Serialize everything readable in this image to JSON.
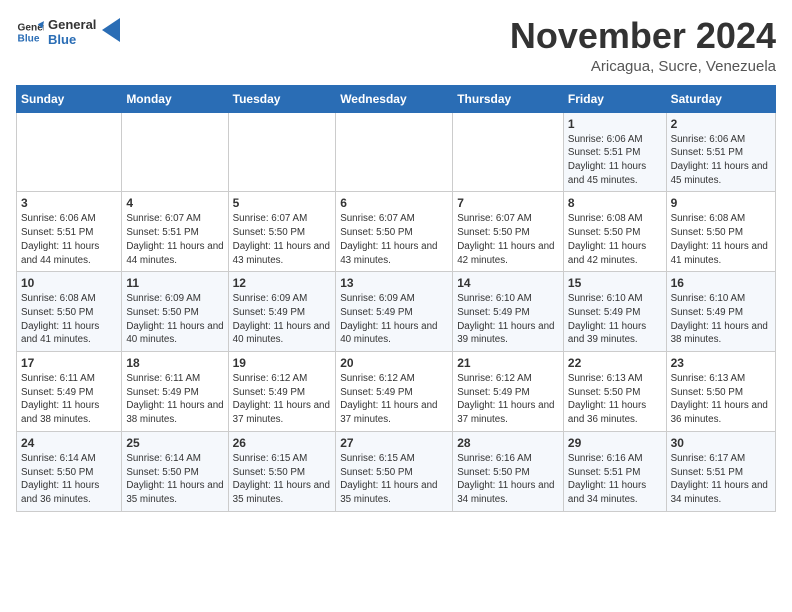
{
  "header": {
    "logo_general": "General",
    "logo_blue": "Blue",
    "month": "November 2024",
    "location": "Aricagua, Sucre, Venezuela"
  },
  "days_of_week": [
    "Sunday",
    "Monday",
    "Tuesday",
    "Wednesday",
    "Thursday",
    "Friday",
    "Saturday"
  ],
  "weeks": [
    [
      {
        "day": "",
        "info": ""
      },
      {
        "day": "",
        "info": ""
      },
      {
        "day": "",
        "info": ""
      },
      {
        "day": "",
        "info": ""
      },
      {
        "day": "",
        "info": ""
      },
      {
        "day": "1",
        "info": "Sunrise: 6:06 AM\nSunset: 5:51 PM\nDaylight: 11 hours and 45 minutes."
      },
      {
        "day": "2",
        "info": "Sunrise: 6:06 AM\nSunset: 5:51 PM\nDaylight: 11 hours and 45 minutes."
      }
    ],
    [
      {
        "day": "3",
        "info": "Sunrise: 6:06 AM\nSunset: 5:51 PM\nDaylight: 11 hours and 44 minutes."
      },
      {
        "day": "4",
        "info": "Sunrise: 6:07 AM\nSunset: 5:51 PM\nDaylight: 11 hours and 44 minutes."
      },
      {
        "day": "5",
        "info": "Sunrise: 6:07 AM\nSunset: 5:50 PM\nDaylight: 11 hours and 43 minutes."
      },
      {
        "day": "6",
        "info": "Sunrise: 6:07 AM\nSunset: 5:50 PM\nDaylight: 11 hours and 43 minutes."
      },
      {
        "day": "7",
        "info": "Sunrise: 6:07 AM\nSunset: 5:50 PM\nDaylight: 11 hours and 42 minutes."
      },
      {
        "day": "8",
        "info": "Sunrise: 6:08 AM\nSunset: 5:50 PM\nDaylight: 11 hours and 42 minutes."
      },
      {
        "day": "9",
        "info": "Sunrise: 6:08 AM\nSunset: 5:50 PM\nDaylight: 11 hours and 41 minutes."
      }
    ],
    [
      {
        "day": "10",
        "info": "Sunrise: 6:08 AM\nSunset: 5:50 PM\nDaylight: 11 hours and 41 minutes."
      },
      {
        "day": "11",
        "info": "Sunrise: 6:09 AM\nSunset: 5:50 PM\nDaylight: 11 hours and 40 minutes."
      },
      {
        "day": "12",
        "info": "Sunrise: 6:09 AM\nSunset: 5:49 PM\nDaylight: 11 hours and 40 minutes."
      },
      {
        "day": "13",
        "info": "Sunrise: 6:09 AM\nSunset: 5:49 PM\nDaylight: 11 hours and 40 minutes."
      },
      {
        "day": "14",
        "info": "Sunrise: 6:10 AM\nSunset: 5:49 PM\nDaylight: 11 hours and 39 minutes."
      },
      {
        "day": "15",
        "info": "Sunrise: 6:10 AM\nSunset: 5:49 PM\nDaylight: 11 hours and 39 minutes."
      },
      {
        "day": "16",
        "info": "Sunrise: 6:10 AM\nSunset: 5:49 PM\nDaylight: 11 hours and 38 minutes."
      }
    ],
    [
      {
        "day": "17",
        "info": "Sunrise: 6:11 AM\nSunset: 5:49 PM\nDaylight: 11 hours and 38 minutes."
      },
      {
        "day": "18",
        "info": "Sunrise: 6:11 AM\nSunset: 5:49 PM\nDaylight: 11 hours and 38 minutes."
      },
      {
        "day": "19",
        "info": "Sunrise: 6:12 AM\nSunset: 5:49 PM\nDaylight: 11 hours and 37 minutes."
      },
      {
        "day": "20",
        "info": "Sunrise: 6:12 AM\nSunset: 5:49 PM\nDaylight: 11 hours and 37 minutes."
      },
      {
        "day": "21",
        "info": "Sunrise: 6:12 AM\nSunset: 5:49 PM\nDaylight: 11 hours and 37 minutes."
      },
      {
        "day": "22",
        "info": "Sunrise: 6:13 AM\nSunset: 5:50 PM\nDaylight: 11 hours and 36 minutes."
      },
      {
        "day": "23",
        "info": "Sunrise: 6:13 AM\nSunset: 5:50 PM\nDaylight: 11 hours and 36 minutes."
      }
    ],
    [
      {
        "day": "24",
        "info": "Sunrise: 6:14 AM\nSunset: 5:50 PM\nDaylight: 11 hours and 36 minutes."
      },
      {
        "day": "25",
        "info": "Sunrise: 6:14 AM\nSunset: 5:50 PM\nDaylight: 11 hours and 35 minutes."
      },
      {
        "day": "26",
        "info": "Sunrise: 6:15 AM\nSunset: 5:50 PM\nDaylight: 11 hours and 35 minutes."
      },
      {
        "day": "27",
        "info": "Sunrise: 6:15 AM\nSunset: 5:50 PM\nDaylight: 11 hours and 35 minutes."
      },
      {
        "day": "28",
        "info": "Sunrise: 6:16 AM\nSunset: 5:50 PM\nDaylight: 11 hours and 34 minutes."
      },
      {
        "day": "29",
        "info": "Sunrise: 6:16 AM\nSunset: 5:51 PM\nDaylight: 11 hours and 34 minutes."
      },
      {
        "day": "30",
        "info": "Sunrise: 6:17 AM\nSunset: 5:51 PM\nDaylight: 11 hours and 34 minutes."
      }
    ]
  ]
}
